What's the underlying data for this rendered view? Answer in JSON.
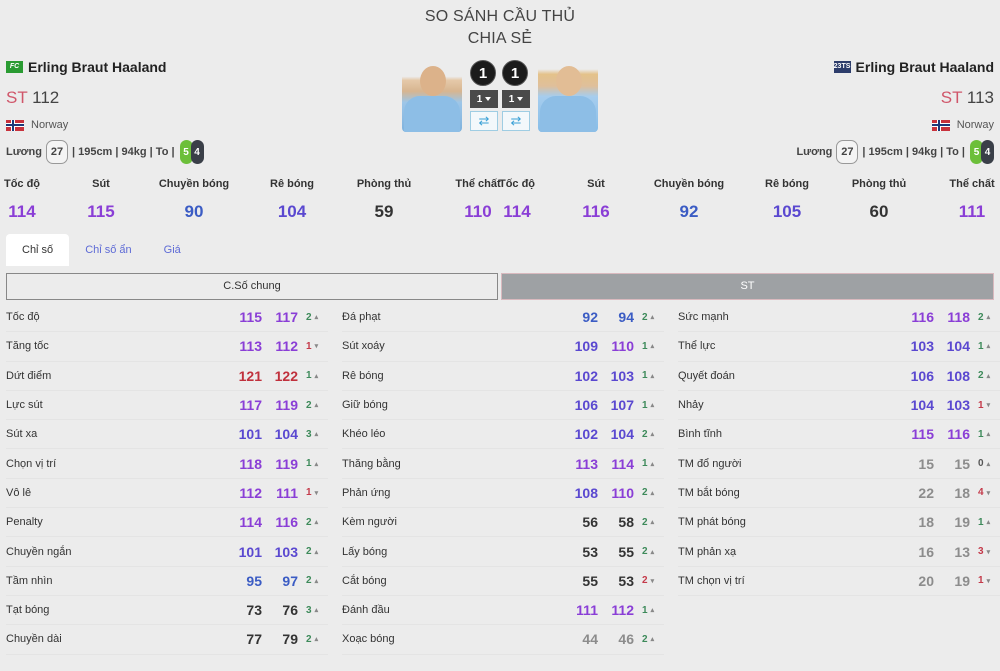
{
  "header": {
    "title": "SO SÁNH CẦU THỦ",
    "subtitle": "CHIA SẺ"
  },
  "players": [
    {
      "season_badge": "FC",
      "name": "Erling Braut Haaland",
      "position": "ST",
      "ovr": "112",
      "nation": "Norway",
      "wage_label": "Lương",
      "wage": "27",
      "info": "| 195cm | 94kg | To |",
      "left_foot": "5",
      "right_foot": "4",
      "level": "1",
      "upgrade": "1",
      "summary": [
        {
          "label": "Tốc độ",
          "value": "114",
          "color": "#8a3ed6"
        },
        {
          "label": "Sút",
          "value": "115",
          "color": "#8a3ed6"
        },
        {
          "label": "Chuyền bóng",
          "value": "90",
          "color": "#3b5cc4"
        },
        {
          "label": "Rê bóng",
          "value": "104",
          "color": "#5a48d0"
        },
        {
          "label": "Phòng thủ",
          "value": "59",
          "color": "#333333"
        },
        {
          "label": "Thể chất",
          "value": "110",
          "color": "#8a3ed6"
        }
      ]
    },
    {
      "season_badge": "23TS",
      "name": "Erling Braut Haaland",
      "position": "ST",
      "ovr": "113",
      "nation": "Norway",
      "wage_label": "Lương",
      "wage": "27",
      "info": "| 195cm | 94kg | To |",
      "left_foot": "5",
      "right_foot": "4",
      "level": "1",
      "upgrade": "1",
      "summary": [
        {
          "label": "Tốc độ",
          "value": "114",
          "color": "#8a3ed6"
        },
        {
          "label": "Sút",
          "value": "116",
          "color": "#8a3ed6"
        },
        {
          "label": "Chuyền bóng",
          "value": "92",
          "color": "#3b5cc4"
        },
        {
          "label": "Rê bóng",
          "value": "105",
          "color": "#5a48d0"
        },
        {
          "label": "Phòng thủ",
          "value": "60",
          "color": "#333333"
        },
        {
          "label": "Thể chất",
          "value": "111",
          "color": "#8a3ed6"
        }
      ]
    }
  ],
  "tabs": [
    {
      "label": "Chỉ số",
      "active": true
    },
    {
      "label": "Chỉ số ẩn",
      "active": false
    },
    {
      "label": "Giá",
      "active": false
    }
  ],
  "segments": {
    "general": "C.Số chung",
    "position": "ST"
  },
  "colors": {
    "purple": "#8a3ed6",
    "indigo": "#5a48d0",
    "blue": "#3b5cc4",
    "red": "#c0303c",
    "dark": "#333333",
    "gray": "#8c8c8c",
    "up": "#3d8a5a",
    "down": "#c43a4a"
  },
  "stats": [
    [
      {
        "name": "Tốc độ",
        "a": "115",
        "b": "117",
        "diff": "2",
        "dir": "up",
        "ca": "purple",
        "cb": "purple"
      },
      {
        "name": "Tăng tốc",
        "a": "113",
        "b": "112",
        "diff": "1",
        "dir": "down",
        "ca": "purple",
        "cb": "purple"
      },
      {
        "name": "Dứt điểm",
        "a": "121",
        "b": "122",
        "diff": "1",
        "dir": "up",
        "ca": "red",
        "cb": "red"
      },
      {
        "name": "Lực sút",
        "a": "117",
        "b": "119",
        "diff": "2",
        "dir": "up",
        "ca": "purple",
        "cb": "purple"
      },
      {
        "name": "Sút xa",
        "a": "101",
        "b": "104",
        "diff": "3",
        "dir": "up",
        "ca": "indigo",
        "cb": "indigo"
      },
      {
        "name": "Chọn vị trí",
        "a": "118",
        "b": "119",
        "diff": "1",
        "dir": "up",
        "ca": "purple",
        "cb": "purple"
      },
      {
        "name": "Vô lê",
        "a": "112",
        "b": "111",
        "diff": "1",
        "dir": "down",
        "ca": "purple",
        "cb": "purple"
      },
      {
        "name": "Penalty",
        "a": "114",
        "b": "116",
        "diff": "2",
        "dir": "up",
        "ca": "purple",
        "cb": "purple"
      },
      {
        "name": "Chuyền ngắn",
        "a": "101",
        "b": "103",
        "diff": "2",
        "dir": "up",
        "ca": "indigo",
        "cb": "indigo"
      },
      {
        "name": "Tầm nhìn",
        "a": "95",
        "b": "97",
        "diff": "2",
        "dir": "up",
        "ca": "blue",
        "cb": "blue"
      },
      {
        "name": "Tạt bóng",
        "a": "73",
        "b": "76",
        "diff": "3",
        "dir": "up",
        "ca": "dark",
        "cb": "dark"
      },
      {
        "name": "Chuyền dài",
        "a": "77",
        "b": "79",
        "diff": "2",
        "dir": "up",
        "ca": "dark",
        "cb": "dark"
      }
    ],
    [
      {
        "name": "Đá phạt",
        "a": "92",
        "b": "94",
        "diff": "2",
        "dir": "up",
        "ca": "blue",
        "cb": "blue"
      },
      {
        "name": "Sút xoáy",
        "a": "109",
        "b": "110",
        "diff": "1",
        "dir": "up",
        "ca": "indigo",
        "cb": "purple"
      },
      {
        "name": "Rê bóng",
        "a": "102",
        "b": "103",
        "diff": "1",
        "dir": "up",
        "ca": "indigo",
        "cb": "indigo"
      },
      {
        "name": "Giữ bóng",
        "a": "106",
        "b": "107",
        "diff": "1",
        "dir": "up",
        "ca": "indigo",
        "cb": "indigo"
      },
      {
        "name": "Khéo léo",
        "a": "102",
        "b": "104",
        "diff": "2",
        "dir": "up",
        "ca": "indigo",
        "cb": "indigo"
      },
      {
        "name": "Thăng bằng",
        "a": "113",
        "b": "114",
        "diff": "1",
        "dir": "up",
        "ca": "purple",
        "cb": "purple"
      },
      {
        "name": "Phản ứng",
        "a": "108",
        "b": "110",
        "diff": "2",
        "dir": "up",
        "ca": "indigo",
        "cb": "purple"
      },
      {
        "name": "Kèm người",
        "a": "56",
        "b": "58",
        "diff": "2",
        "dir": "up",
        "ca": "dark",
        "cb": "dark"
      },
      {
        "name": "Lấy bóng",
        "a": "53",
        "b": "55",
        "diff": "2",
        "dir": "up",
        "ca": "dark",
        "cb": "dark"
      },
      {
        "name": "Cắt bóng",
        "a": "55",
        "b": "53",
        "diff": "2",
        "dir": "down",
        "ca": "dark",
        "cb": "dark"
      },
      {
        "name": "Đánh đầu",
        "a": "111",
        "b": "112",
        "diff": "1",
        "dir": "up",
        "ca": "purple",
        "cb": "purple"
      },
      {
        "name": "Xoạc bóng",
        "a": "44",
        "b": "46",
        "diff": "2",
        "dir": "up",
        "ca": "gray",
        "cb": "gray"
      }
    ],
    [
      {
        "name": "Sức mạnh",
        "a": "116",
        "b": "118",
        "diff": "2",
        "dir": "up",
        "ca": "purple",
        "cb": "purple"
      },
      {
        "name": "Thể lực",
        "a": "103",
        "b": "104",
        "diff": "1",
        "dir": "up",
        "ca": "indigo",
        "cb": "indigo"
      },
      {
        "name": "Quyết đoán",
        "a": "106",
        "b": "108",
        "diff": "2",
        "dir": "up",
        "ca": "indigo",
        "cb": "indigo"
      },
      {
        "name": "Nhảy",
        "a": "104",
        "b": "103",
        "diff": "1",
        "dir": "down",
        "ca": "indigo",
        "cb": "indigo"
      },
      {
        "name": "Bình tĩnh",
        "a": "115",
        "b": "116",
        "diff": "1",
        "dir": "up",
        "ca": "purple",
        "cb": "purple"
      },
      {
        "name": "TM đổ người",
        "a": "15",
        "b": "15",
        "diff": "0",
        "dir": "flat",
        "ca": "gray",
        "cb": "gray"
      },
      {
        "name": "TM bắt bóng",
        "a": "22",
        "b": "18",
        "diff": "4",
        "dir": "down",
        "ca": "gray",
        "cb": "gray"
      },
      {
        "name": "TM phát bóng",
        "a": "18",
        "b": "19",
        "diff": "1",
        "dir": "up",
        "ca": "gray",
        "cb": "gray"
      },
      {
        "name": "TM phản xạ",
        "a": "16",
        "b": "13",
        "diff": "3",
        "dir": "down",
        "ca": "gray",
        "cb": "gray"
      },
      {
        "name": "TM chọn vị trí",
        "a": "20",
        "b": "19",
        "diff": "1",
        "dir": "down",
        "ca": "gray",
        "cb": "gray"
      }
    ]
  ]
}
